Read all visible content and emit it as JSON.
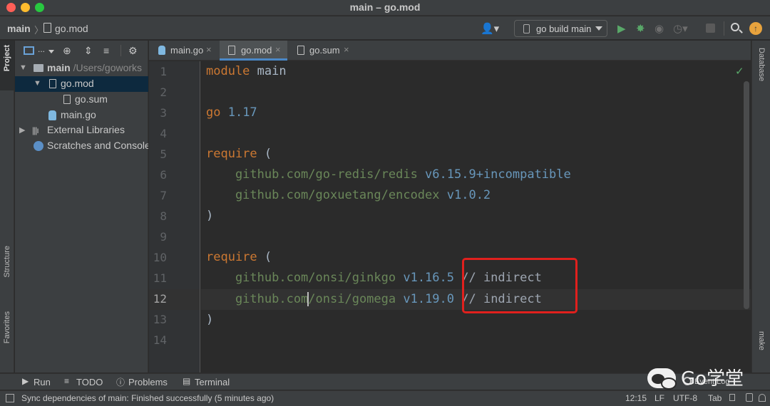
{
  "window": {
    "title": "main – go.mod"
  },
  "nav": {
    "breadcrumb_project": "main",
    "breadcrumb_separator": "〉",
    "breadcrumb_file": "go.mod",
    "run_config": "go build main"
  },
  "left_tabs": {
    "project": "Project",
    "structure": "Structure",
    "favorites": "Favorites"
  },
  "right_tabs": {
    "database": "Database",
    "make": "make"
  },
  "project_tree": {
    "view_dots": "...",
    "root_name": "main",
    "root_path": " /Users/goworks",
    "items": [
      {
        "label": "go.mod"
      },
      {
        "label": "go.sum"
      },
      {
        "label": "main.go"
      },
      {
        "label": "External Libraries"
      },
      {
        "label": "Scratches and Consoles"
      }
    ]
  },
  "tabs": [
    {
      "label": "main.go",
      "close": "×"
    },
    {
      "label": "go.mod",
      "close": "×"
    },
    {
      "label": "go.sum",
      "close": "×"
    }
  ],
  "editor": {
    "line_numbers": [
      "1",
      "2",
      "3",
      "4",
      "5",
      "6",
      "7",
      "8",
      "9",
      "10",
      "11",
      "12",
      "13",
      "14"
    ],
    "current_line": "12",
    "code": {
      "l1_kw": "module",
      "l1_name": " main",
      "l3_kw": "go",
      "l3_ver": " 1.17",
      "l5_kw": "require",
      "l5_paren": " (",
      "l6_path": "    github.com/go-redis/redis",
      "l6_ver": " v6.15.9+incompatible",
      "l7_path": "    github.com/goxuetang/encodex",
      "l7_ver": " v1.0.2",
      "l8_paren": ")",
      "l10_kw": "require",
      "l10_paren": " (",
      "l11_path": "    github.com/onsi/ginkgo",
      "l11_ver": " v1.16.5",
      "l11_cmt": " // indirect",
      "l12_path_a": "    github.com",
      "l12_path_b": "/onsi/gomega",
      "l12_ver": " v1.19.0",
      "l12_cmt": " // indirect",
      "l13_paren": ")"
    },
    "highlight_color": "#e0201d"
  },
  "bottom_tools": {
    "run": "Run",
    "todo": "TODO",
    "problems": "Problems",
    "terminal": "Terminal",
    "event_log": "Event Log",
    "watermark": "Go学堂"
  },
  "status": {
    "message": "Sync dependencies of main: Finished successfully (5 minutes ago)",
    "position": "12:15",
    "line_sep": "LF",
    "encoding": "UTF-8",
    "indent": "Tab"
  },
  "colors": {
    "keyword": "#cc7832",
    "number": "#6897bb",
    "string_path": "#6a8759",
    "accent_blue": "#4a88c7",
    "run_green": "#59a869"
  }
}
